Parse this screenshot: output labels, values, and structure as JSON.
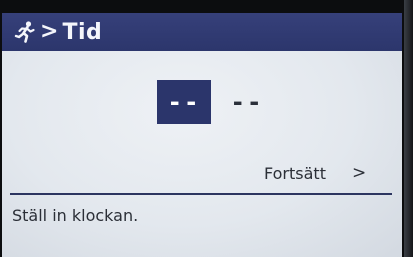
{
  "header": {
    "icon": "running-person-icon",
    "separator": ">",
    "title": "Tid"
  },
  "time": {
    "hours": "--",
    "minutes": "--"
  },
  "actions": {
    "continue_label": "Fortsätt",
    "continue_arrow": ">"
  },
  "status": {
    "message": "Ställ in klockan."
  },
  "colors": {
    "header_bg": "#2c366c",
    "selected_bg": "#2b356b",
    "screen_bg": "#e6ebf0",
    "text": "#2b2f37"
  }
}
